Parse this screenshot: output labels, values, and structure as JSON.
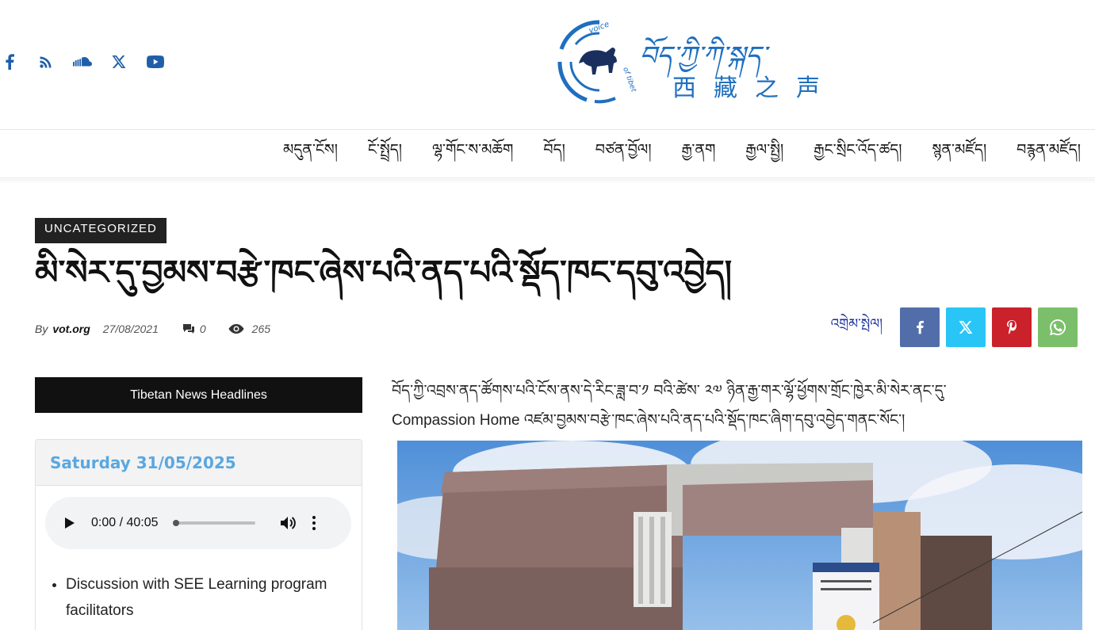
{
  "header": {
    "social": [
      {
        "name": "facebook-icon"
      },
      {
        "name": "rss-icon"
      },
      {
        "name": "soundcloud-icon"
      },
      {
        "name": "x-twitter-icon"
      },
      {
        "name": "youtube-icon"
      }
    ],
    "logo": {
      "emblem_text": "voice of tibet",
      "tibetan_title": "བོད་ཀྱི་ཀི་སྐད་",
      "chinese_title": "西藏之声"
    },
    "accent_color": "#1f6fbf"
  },
  "nav": {
    "items": [
      "མདུན་ངོས།",
      "ངོ་སྤྲོད།",
      "ལྷ་གོང་ས་མཆོག",
      "བོད།",
      "བཙན་བྱོལ།",
      "རྒྱ་ནག",
      "རྒྱལ་སྤྱི།",
      "རྒྱང་སྲིང་འོད་ཚད།",
      "སྙན་མཛོད།",
      "བརྙན་མཛོད།"
    ]
  },
  "article": {
    "category": "UNCATEGORIZED",
    "headline": "མི་སེར་དུ་བྱམས་བརྩེ་ཁང་ཞེས་པའི་ནད་པའི་སྡོད་ཁང་དབུ་འབྱེད།",
    "meta": {
      "by": "By",
      "author": "vot.org",
      "date": "27/08/2021",
      "comments": "0",
      "views": "265"
    },
    "share": {
      "label": "འགྲེམ་སྤེལ།",
      "buttons": [
        {
          "name": "share-facebook-button",
          "color": "#516eab"
        },
        {
          "name": "share-x-button",
          "color": "#29c5f6"
        },
        {
          "name": "share-pinterest-button",
          "color": "#ca212a"
        },
        {
          "name": "share-whatsapp-button",
          "color": "#7bbf6a"
        }
      ]
    },
    "body_line1": "བོད་ཀྱི་འབྲས་ནད་ཚོགས་པའི་ངོས་ནས་དེ་རིང་ཟླ་བ་༡ བའི་ཚེས་ ༢༧ ཉིན་རྒྱ་གར་ལྷོ་ཕྱོགས་གྲོང་ཁྱེར་མི་སེར་ནང་དུ་",
    "body_line2": "Compassion Home འཛམ་བྱམས་བརྩེ་ཁང་ཞེས་པའི་ནད་པའི་སྡོད་ཁང་ཞིག་དབུ་འབྱེད་གནང་སོང་།"
  },
  "sidebar": {
    "heading": "Tibetan News Headlines",
    "date": "Saturday 31/05/2025",
    "audio": {
      "time": "0:00 / 40:05",
      "progress": 0
    },
    "list": [
      "Discussion with SEE Learning program facilitators"
    ]
  }
}
